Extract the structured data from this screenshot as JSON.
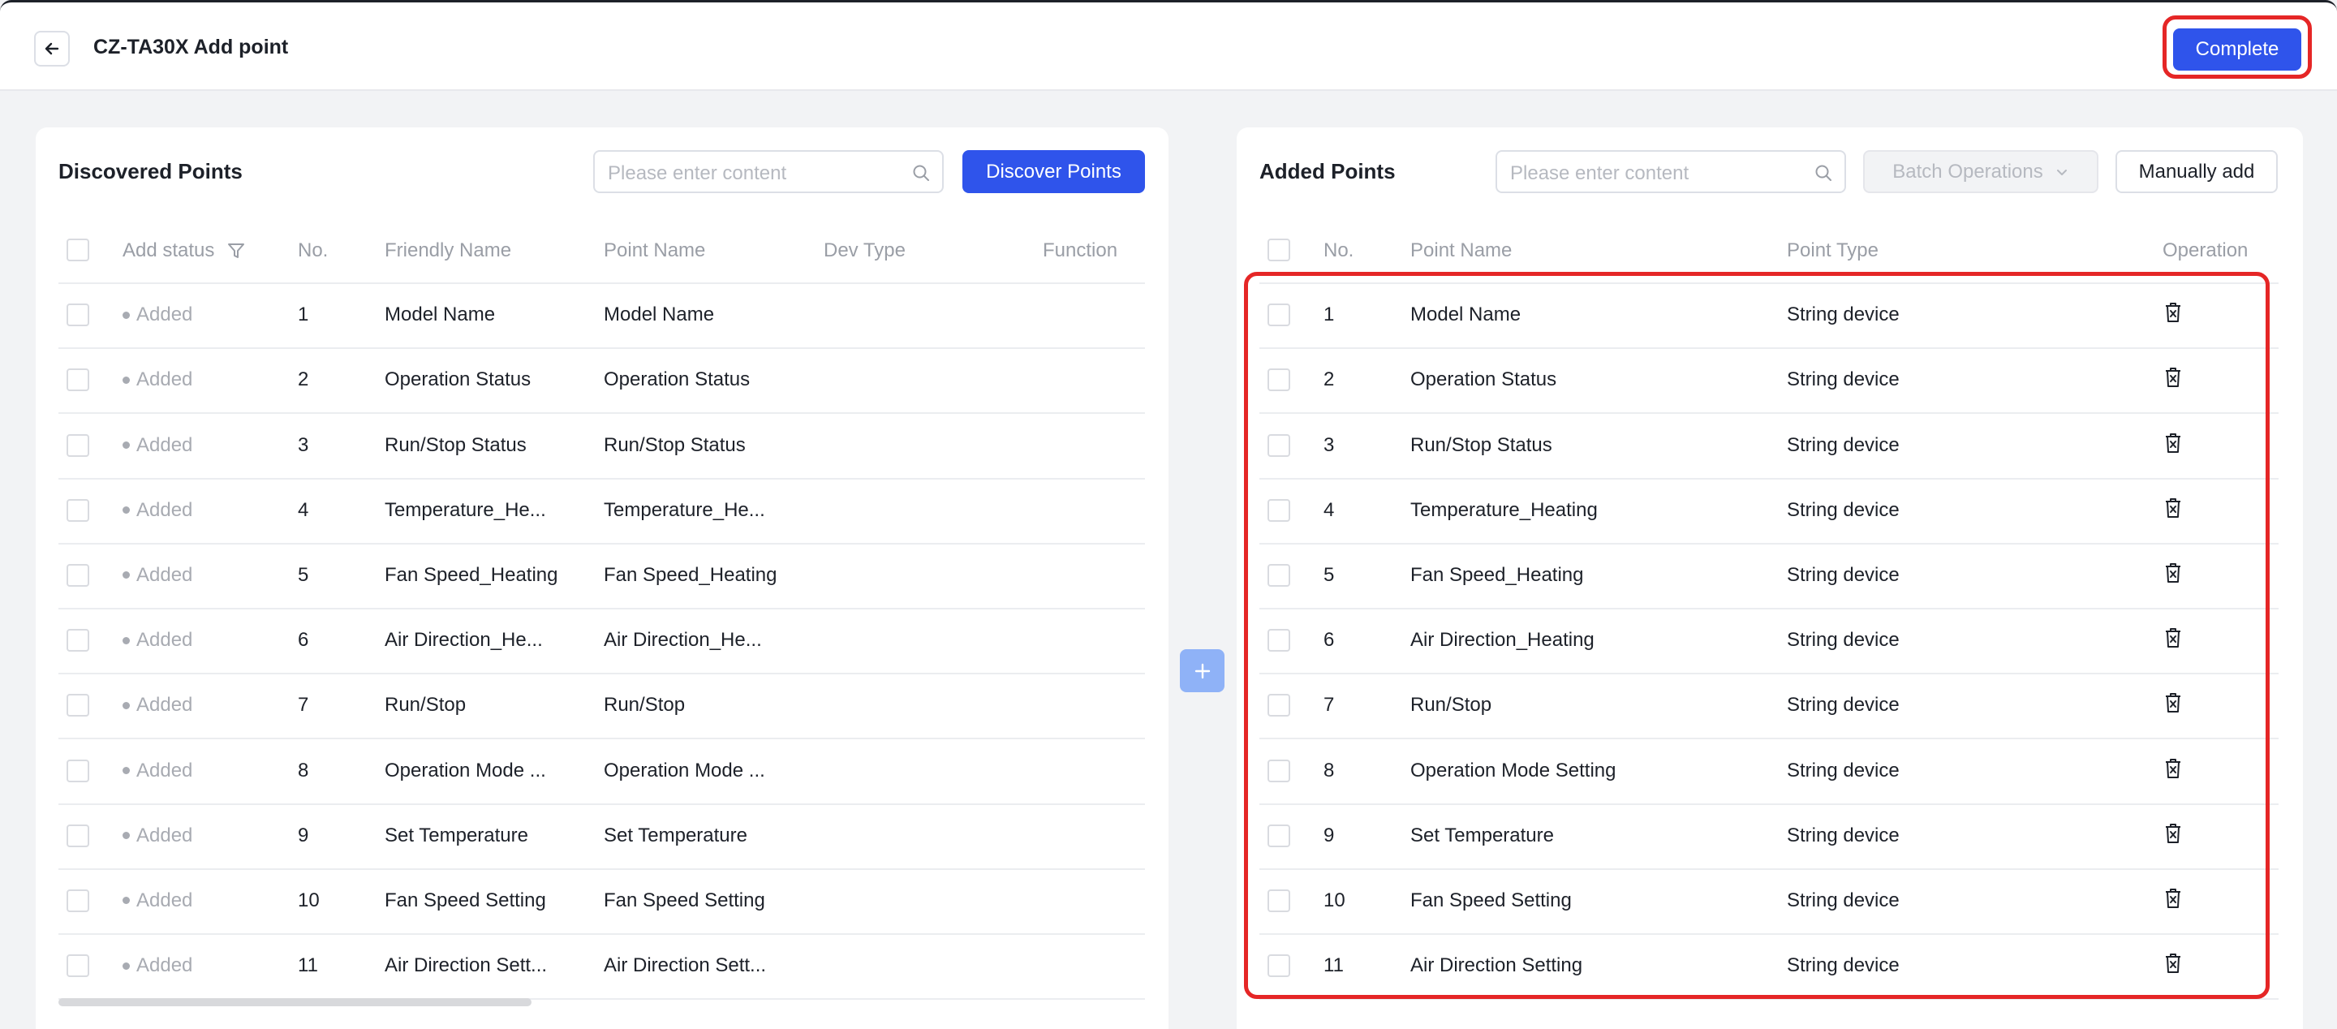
{
  "header": {
    "title": "CZ-TA30X Add point",
    "complete_label": "Complete"
  },
  "discovered": {
    "title": "Discovered Points",
    "search_placeholder": "Please enter content",
    "discover_label": "Discover Points",
    "columns": [
      "Add status",
      "No.",
      "Friendly Name",
      "Point Name",
      "Dev Type",
      "Function"
    ],
    "rows": [
      {
        "status": "Added",
        "no": "1",
        "friendly": "Model Name",
        "point": "Model Name"
      },
      {
        "status": "Added",
        "no": "2",
        "friendly": "Operation Status",
        "point": "Operation Status"
      },
      {
        "status": "Added",
        "no": "3",
        "friendly": "Run/Stop Status",
        "point": "Run/Stop Status"
      },
      {
        "status": "Added",
        "no": "4",
        "friendly": "Temperature_He...",
        "point": "Temperature_He..."
      },
      {
        "status": "Added",
        "no": "5",
        "friendly": "Fan Speed_Heating",
        "point": "Fan Speed_Heating"
      },
      {
        "status": "Added",
        "no": "6",
        "friendly": "Air Direction_He...",
        "point": "Air Direction_He..."
      },
      {
        "status": "Added",
        "no": "7",
        "friendly": "Run/Stop",
        "point": "Run/Stop"
      },
      {
        "status": "Added",
        "no": "8",
        "friendly": "Operation Mode ...",
        "point": "Operation Mode ..."
      },
      {
        "status": "Added",
        "no": "9",
        "friendly": "Set Temperature",
        "point": "Set Temperature"
      },
      {
        "status": "Added",
        "no": "10",
        "friendly": "Fan Speed Setting",
        "point": "Fan Speed Setting"
      },
      {
        "status": "Added",
        "no": "11",
        "friendly": "Air Direction Sett...",
        "point": "Air Direction Sett..."
      }
    ]
  },
  "added": {
    "title": "Added Points",
    "search_placeholder": "Please enter content",
    "batch_label": "Batch Operations",
    "manual_label": "Manually add",
    "columns": [
      "No.",
      "Point Name",
      "Point Type",
      "Operation"
    ],
    "rows": [
      {
        "no": "1",
        "point": "Model Name",
        "type": "String device"
      },
      {
        "no": "2",
        "point": "Operation Status",
        "type": "String device"
      },
      {
        "no": "3",
        "point": "Run/Stop Status",
        "type": "String device"
      },
      {
        "no": "4",
        "point": "Temperature_Heating",
        "type": "String device"
      },
      {
        "no": "5",
        "point": "Fan Speed_Heating",
        "type": "String device"
      },
      {
        "no": "6",
        "point": "Air Direction_Heating",
        "type": "String device"
      },
      {
        "no": "7",
        "point": "Run/Stop",
        "type": "String device"
      },
      {
        "no": "8",
        "point": "Operation Mode Setting",
        "type": "String device"
      },
      {
        "no": "9",
        "point": "Set Temperature",
        "type": "String device"
      },
      {
        "no": "10",
        "point": "Fan Speed Setting",
        "type": "String device"
      },
      {
        "no": "11",
        "point": "Air Direction Setting",
        "type": "String device"
      }
    ]
  },
  "colors": {
    "primary": "#2f54eb",
    "highlight": "#e52626",
    "transfer": "#8fb2f7"
  },
  "icons": [
    "arrow-left-icon",
    "search-icon",
    "filter-icon",
    "chevron-down-icon",
    "plus-icon",
    "trash-icon"
  ]
}
